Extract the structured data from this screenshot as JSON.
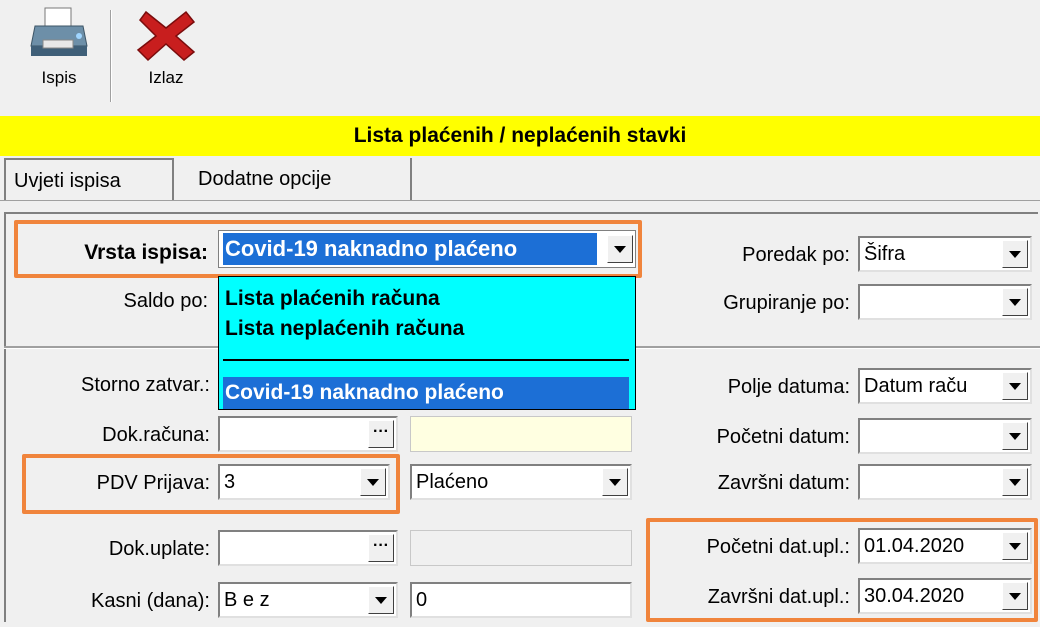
{
  "toolbar": {
    "print_label": "Ispis",
    "exit_label": "Izlaz"
  },
  "title": "Lista plaćenih / neplaćenih stavki",
  "tabs": [
    {
      "label": "Uvjeti ispisa",
      "active": true
    },
    {
      "label": "Dodatne opcije",
      "active": false
    }
  ],
  "form": {
    "vrsta_ispisa": {
      "label": "Vrsta ispisa:",
      "value": "Covid-19 naknadno plaćeno"
    },
    "saldo_po": {
      "label": "Saldo po:"
    },
    "dropdown_options": [
      "Lista plaćenih računa",
      "Lista neplaćenih računa",
      "Covid-19 naknadno plaćeno"
    ],
    "storno_zatvar": {
      "label": "Storno zatvar.:"
    },
    "dok_racuna": {
      "label": "Dok.računa:",
      "value": ""
    },
    "pdv_prijava": {
      "label": "PDV Prijava:",
      "value": "3"
    },
    "placeno": {
      "value": "Plaćeno"
    },
    "dok_uplate": {
      "label": "Dok.uplate:",
      "value": ""
    },
    "kasni_dana": {
      "label": "Kasni (dana):",
      "value": "B e z"
    },
    "kasni_num": {
      "value": "0"
    },
    "poredak_po": {
      "label": "Poredak po:",
      "value": "Šifra"
    },
    "grupiranje_po": {
      "label": "Grupiranje po:",
      "value": ""
    },
    "polje_datuma": {
      "label": "Polje datuma:",
      "value": "Datum raču"
    },
    "pocetni_datum": {
      "label": "Početni datum:",
      "value": ""
    },
    "zavrsni_datum": {
      "label": "Završni datum:",
      "value": ""
    },
    "pocetni_dat_upl": {
      "label": "Početni dat.upl.:",
      "value": "01.04.2020"
    },
    "zavrsni_dat_upl": {
      "label": "Završni dat.upl.:",
      "value": "30.04.2020"
    }
  },
  "colors": {
    "title_bg": "#ffff00",
    "highlight": "#f0843c",
    "dropdown_bg": "#00ffff",
    "selection": "#1c6fd6"
  }
}
